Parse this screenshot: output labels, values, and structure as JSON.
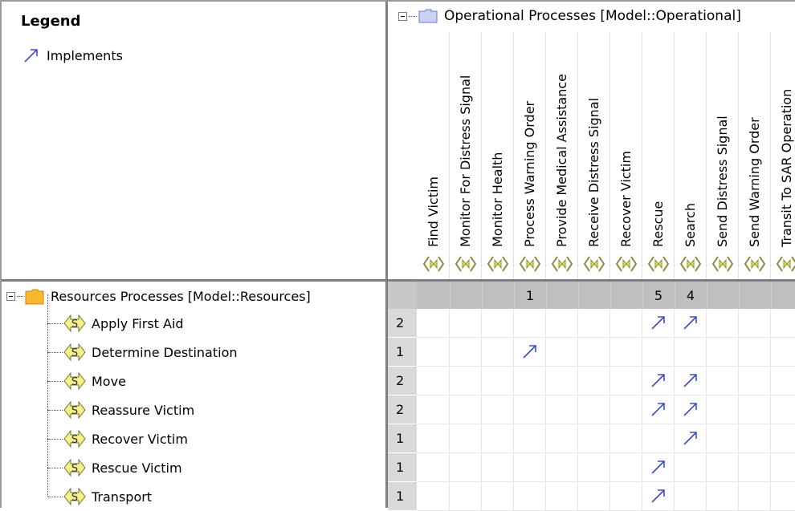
{
  "legend": {
    "title": "Legend",
    "items": [
      {
        "label": "Implements",
        "icon": "implements-arrow-icon",
        "color": "#3d4fb5"
      }
    ]
  },
  "columns_group": {
    "label": "Operational Processes [Model::Operational]"
  },
  "columns": [
    {
      "label": "Find Victim"
    },
    {
      "label": "Monitor For Distress Signal"
    },
    {
      "label": "Monitor Health"
    },
    {
      "label": "Process Warning Order"
    },
    {
      "label": "Provide Medical Assistance"
    },
    {
      "label": "Receive Distress Signal"
    },
    {
      "label": "Recover Victim"
    },
    {
      "label": "Rescue"
    },
    {
      "label": "Search"
    },
    {
      "label": "Send Distress Signal"
    },
    {
      "label": "Send Warning Order"
    },
    {
      "label": "Transit To SAR Operation"
    }
  ],
  "column_totals": [
    "",
    "",
    "",
    "1",
    "",
    "",
    "",
    "5",
    "4",
    "",
    "",
    ""
  ],
  "rows_group": {
    "label": "Resources Processes [Model::Resources]"
  },
  "rows": [
    {
      "label": "Apply First Aid",
      "count": "2",
      "links": [
        7,
        8
      ]
    },
    {
      "label": "Determine Destination",
      "count": "1",
      "links": [
        3
      ]
    },
    {
      "label": "Move",
      "count": "2",
      "links": [
        7,
        8
      ]
    },
    {
      "label": "Reassure Victim",
      "count": "2",
      "links": [
        7,
        8
      ]
    },
    {
      "label": "Recover Victim",
      "count": "1",
      "links": [
        8
      ]
    },
    {
      "label": "Rescue Victim",
      "count": "1",
      "links": [
        7
      ]
    },
    {
      "label": "Transport",
      "count": "1",
      "links": [
        7
      ]
    }
  ],
  "colors": {
    "arrow": "#3d4fb5",
    "folder": "#f7b731",
    "column_folder": "#c9cff5",
    "count_bg": "#d9d9d9",
    "total_band": "#bfbfbf"
  }
}
